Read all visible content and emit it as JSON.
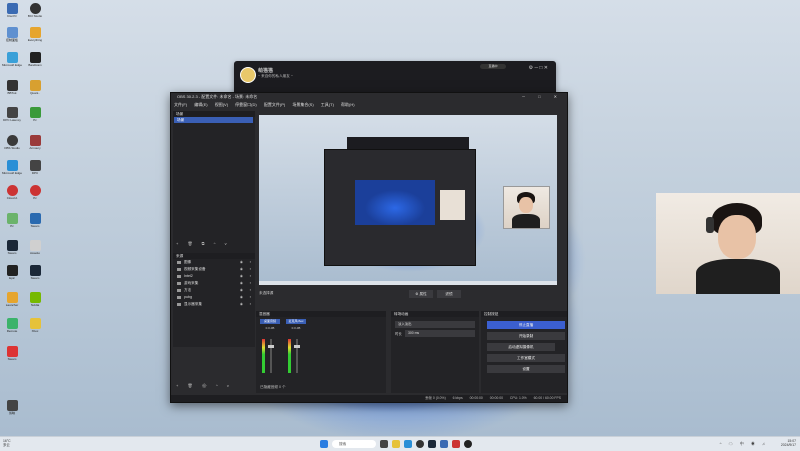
{
  "desktop": {
    "icons_col1": [
      "Kiwi Pc",
      "控制面板",
      "Microsoft Edge",
      "BBTuk",
      "DPC Latency",
      "OBS Studio",
      "Microsoft Edge",
      "GeForce Exp",
      "Cloud A",
      "Pc",
      "Steam",
      "Epic",
      "Launcher",
      "Remote",
      "Steam",
      "剪映"
    ],
    "icons_col2": [
      "BCI Studio",
      "Everything",
      "Bandicam",
      "Quant..",
      "Pc",
      "Armoury",
      "DPC",
      "Pc",
      "Steam",
      "Assetto",
      "Steam",
      "Nvidia",
      "Xbox",
      "WeGame"
    ]
  },
  "live_window": {
    "streamer_name": "萌猫猫",
    "subtitle": "~ 来自你的私人朋友 ~",
    "badge": "直播中",
    "controls": "⚙ ─ □ ✕"
  },
  "obs": {
    "title": "OBS 30.2.3 - 配置文件: 未命名 - 场景: 未命名",
    "window_controls": "─ □ ✕",
    "menu": [
      "文件(F)",
      "编辑(E)",
      "视图(V)",
      "停靠窗口(D)",
      "配置文件(P)",
      "场景集合(S)",
      "工具(T)",
      "帮助(H)"
    ],
    "scenes_header": "场景",
    "scene_selected": "场景",
    "scene_toolbar": "+ 🗑 ⧉ ^ v",
    "sources_header": "来源",
    "sources": [
      "图像",
      "视频采集设备",
      "Intel2",
      "游戏采集",
      "方法",
      "pubg",
      "显示器采集"
    ],
    "source_toolbar": "+ 🗑 ⚙ ^ v",
    "no_source": "未选择源",
    "props_button": "⚙ 属性",
    "filters_button": "滤镜",
    "mixer_header": "混音器",
    "mixer_channels": [
      {
        "name": "桌面音频",
        "db": "0.0 dB"
      },
      {
        "name": "麦克风/Aux",
        "db": "0.0 dB"
      }
    ],
    "mixer_footer": "已隐藏音频 0 个",
    "transitions_header": "转场动画",
    "transition_type": "淡入淡出",
    "duration_label": "时长",
    "duration_value": "300 ms",
    "controls_header": "控制按钮",
    "controls_buttons": [
      "停止直播",
      "开始录制",
      "启动虚拟摄像机",
      "工作室模式",
      "设置"
    ],
    "statusbar": [
      "丢帧 0 (0.0%)",
      "6 kbps",
      "00:00:00",
      "00:00:00",
      "CPU: 1.0%",
      "60.00 / 60.00 FPS"
    ]
  },
  "taskbar": {
    "weather_temp": "16°C",
    "weather_desc": "多云",
    "search_placeholder": "搜索",
    "time": "15:07",
    "date": "2024/9/17",
    "tray_icons": "^ ☁ 中 ◉ ♫"
  }
}
